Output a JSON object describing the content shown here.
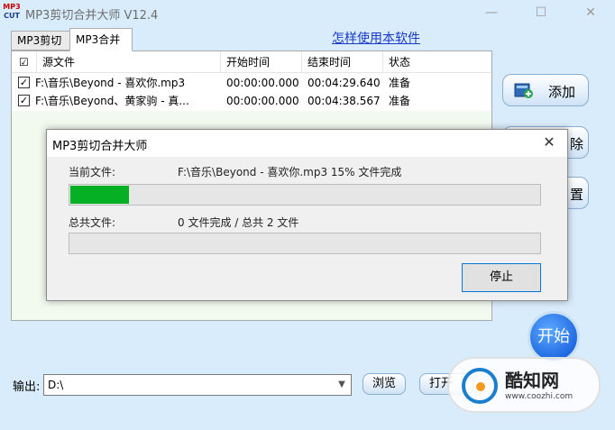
{
  "window": {
    "app_icon_top": "MP3",
    "app_icon_bottom": "CUT",
    "title": "MP3剪切合并大师 V12.4",
    "minimize": "—",
    "maximize": "☐",
    "close": "✕"
  },
  "tabs": [
    {
      "label": "MP3剪切"
    },
    {
      "label": "MP3合并"
    }
  ],
  "help_link": "怎样使用本软件",
  "list": {
    "headers": {
      "check": "☑",
      "source": "源文件",
      "start": "开始时间",
      "end": "结束时间",
      "status": "状态"
    },
    "rows": [
      {
        "checked": "✓",
        "source": "F:\\音乐\\Beyond - 喜欢你.mp3",
        "start": "00:00:00.000",
        "end": "00:04:29.640",
        "status": "准备"
      },
      {
        "checked": "✓",
        "source": "F:\\音乐\\Beyond、黄家驹 - 真...",
        "start": "00:00:00.000",
        "end": "00:04:38.567",
        "status": "准备"
      }
    ]
  },
  "side_buttons": {
    "add": "添加",
    "delete_partial": "除",
    "reset_partial": "置"
  },
  "start_button": "开始",
  "output": {
    "label": "输出:",
    "value": "D:\\",
    "browse": "浏览",
    "open_partial": "打开"
  },
  "dialog": {
    "title": "MP3剪切合并大师",
    "close": "✕",
    "current_label": "当前文件:",
    "current_value": "F:\\音乐\\Beyond - 喜欢你.mp3   15% 文件完成",
    "current_progress": 0.125,
    "total_label": "总共文件:",
    "total_value": "0 文件完成 / 总共 2 文件",
    "total_progress": 0,
    "stop": "停止"
  },
  "watermark": {
    "text": "酷知网",
    "url": "www.coozhi.com"
  }
}
